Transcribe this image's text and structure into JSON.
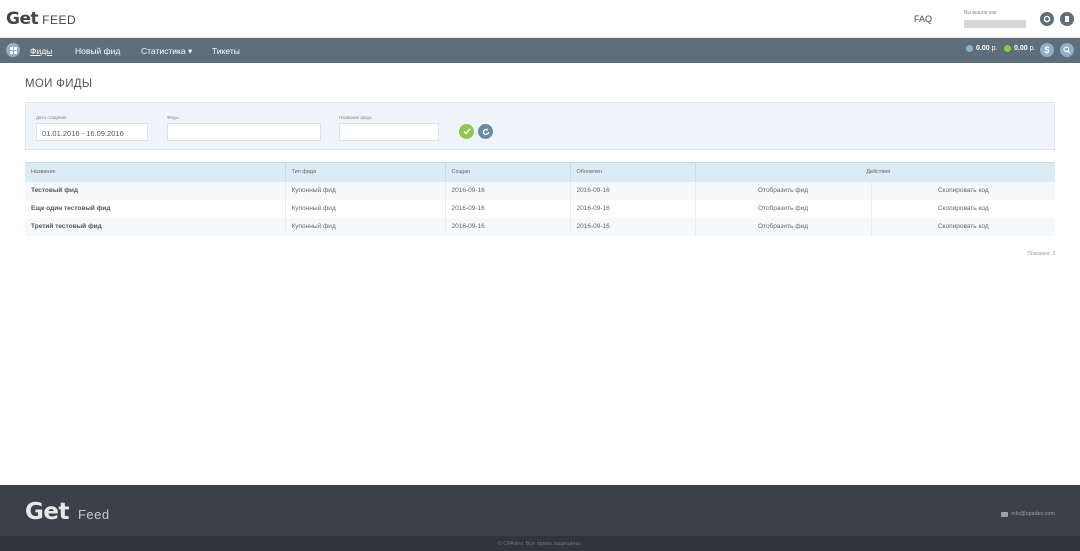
{
  "header": {
    "logo_get": "Get",
    "logo_feed": "FEED",
    "faq": "FAQ",
    "user_label": "Вы вошли как"
  },
  "nav": {
    "items": [
      {
        "label": "Фиды",
        "active": true
      },
      {
        "label": "Новый фид",
        "active": false
      },
      {
        "label": "Статистика ▾",
        "active": false
      },
      {
        "label": "Тикеты",
        "active": false
      }
    ],
    "balances": [
      {
        "value": "0.00",
        "unit": "р.",
        "color": "#8fb0c8"
      },
      {
        "value": "0.00",
        "unit": "р.",
        "color": "#93c54b"
      }
    ],
    "dollar_icon": "$"
  },
  "page": {
    "title": "МОИ ФИДЫ"
  },
  "filters": {
    "date_label": "Дата создания",
    "date_value": "01.01.2016 - 16.09.2016",
    "feeds_label": "Фиды",
    "feeds_value": "",
    "name_label": "Название фида",
    "name_value": ""
  },
  "table": {
    "headers": {
      "name": "Название",
      "type": "Тип фида",
      "created": "Создан",
      "updated": "Обновлен",
      "actions": "Действия"
    },
    "rows": [
      {
        "name": "Тестовый фид",
        "type": "Купонный фид",
        "created": "2016-09-16",
        "updated": "2016-09-16",
        "show": "Отобразить фид",
        "copy": "Скопировать код"
      },
      {
        "name": "Еще один тестовый фид",
        "type": "Купонный фид",
        "created": "2016-09-16",
        "updated": "2016-09-16",
        "show": "Отобразить фид",
        "copy": "Скопировать код"
      },
      {
        "name": "Третий тестовый фид",
        "type": "Купонный фид",
        "created": "2016-09-16",
        "updated": "2016-09-16",
        "show": "Отобразить фид",
        "copy": "Скопировать код"
      }
    ],
    "shown": "Показано: 3"
  },
  "footer": {
    "logo_get": "Get",
    "logo_feed": "Feed",
    "email": "info@cpadev.com",
    "copyright": "© CPAdev. Все права защищены."
  },
  "colors": {
    "navbar": "#5e6e7b",
    "accent_green": "#93c54b",
    "accent_blue": "#8fb0c8",
    "footer": "#3a4149"
  }
}
